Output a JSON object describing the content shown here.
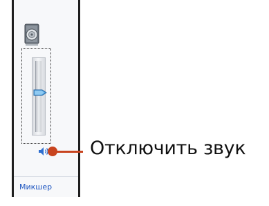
{
  "volume": {
    "level": 0.6,
    "mixer_link": "Микшер",
    "mute_callout": "Отключить звук",
    "device_icon": "speaker-device-icon",
    "mute_icon": "speaker-icon"
  },
  "colors": {
    "callout": "#c8441f",
    "thumb": "#4fa3e0",
    "link": "#1d55c0",
    "frame": "#1e1e1e"
  }
}
